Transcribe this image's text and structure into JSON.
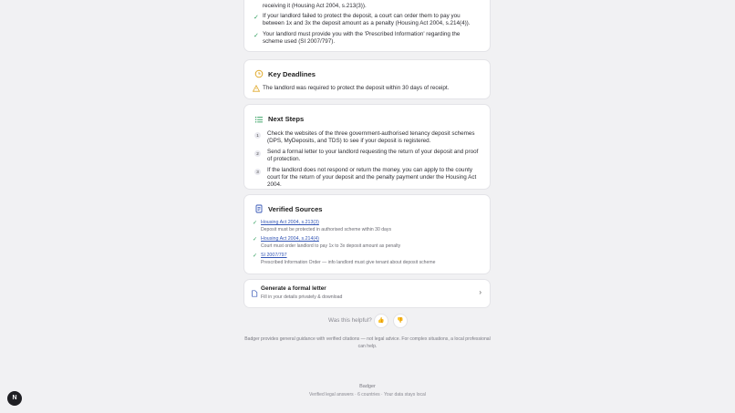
{
  "top_card": {
    "partial_line": "receiving it (Housing Act 2004, s.213(3)).",
    "items": [
      {
        "text": "If your landlord failed to protect the deposit, a court can order them to pay you between 1x and 3x the deposit amount as a penalty (Housing Act 2004, s.214(4))."
      },
      {
        "text": "Your landlord must provide you with the 'Prescribed Information' regarding the scheme used (SI 2007/797)."
      }
    ]
  },
  "deadlines": {
    "title": "Key Deadlines",
    "item": "The landlord was required to protect the deposit within 30 days of receipt."
  },
  "steps": {
    "title": "Next Steps",
    "items": [
      {
        "num": "1",
        "text": "Check the websites of the three government-authorised tenancy deposit schemes (DPS, MyDeposits, and TDS) to see if your deposit is registered."
      },
      {
        "num": "2",
        "text": "Send a formal letter to your landlord requesting the return of your deposit and proof of protection."
      },
      {
        "num": "3",
        "text": "If the landlord does not respond or return the money, you can apply to the county court for the return of your deposit and the penalty payment under the Housing Act 2004."
      }
    ]
  },
  "sources": {
    "title": "Verified Sources",
    "items": [
      {
        "link": "Housing Act 2004, s.213(3)",
        "desc": "Deposit must be protected in authorised scheme within 30 days"
      },
      {
        "link": "Housing Act 2004, s.214(4)",
        "desc": "Court must order landlord to pay 1x to 3x deposit amount as penalty"
      },
      {
        "link": "SI 2007/797",
        "desc": "Prescribed Information Order — info landlord must give tenant about deposit scheme"
      }
    ]
  },
  "generate": {
    "title": "Generate a formal letter",
    "subtitle": "Fill in your details privately & download"
  },
  "feedback": {
    "question": "Was this helpful?"
  },
  "disclaimer": "Badger provides general guidance with verified citations — not legal advice. For complex situations, a local professional can help.",
  "footer": {
    "brand": "Badger",
    "links": [
      "Verified legal answers",
      "6 countries",
      "Your data stays local"
    ]
  },
  "colors": {
    "accent_green": "#2e9d5b",
    "link_blue": "#3456b5",
    "deadline_amber": "#e0a92c",
    "avatar_dark": "#1f1f23"
  }
}
